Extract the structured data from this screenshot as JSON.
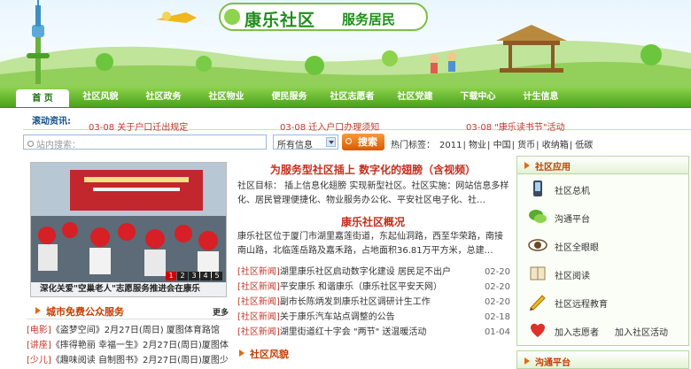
{
  "banner": {
    "title": "康乐社区",
    "slogan": "服务居民"
  },
  "nav": {
    "items": [
      "首 页",
      "社区风貌",
      "社区政务",
      "社区物业",
      "便民服务",
      "社区志愿者",
      "社区党建",
      "下载中心",
      "计生信息"
    ]
  },
  "ticker": {
    "label": "滚动资讯:",
    "rows": [
      {
        "date": "03-08",
        "title": "关于户口迁出规定",
        "y": "bot"
      },
      {
        "date": "03-08",
        "title": "迁入户口办理须知",
        "y": "bot"
      },
      {
        "date": "03-08",
        "title": "\"康乐读书节\"活动",
        "y": "bot"
      }
    ]
  },
  "search": {
    "placeholder": "站内搜索：",
    "select_value": "所有信息",
    "button_label": "搜索",
    "hot_label": "热门标签：",
    "hot_tags": [
      "2011",
      "物业",
      "中国",
      "货币",
      "收纳箱",
      "低碳"
    ]
  },
  "photo": {
    "caption": "深化关爱\"空巢老人\"志愿服务推进会在康乐",
    "pager": [
      "1",
      "2",
      "3",
      "4",
      "5"
    ],
    "active_page": "1"
  },
  "city_services": {
    "title": "城市免费公众服务",
    "more": "更多",
    "items": [
      {
        "tag": "[电影]",
        "text": "《盗梦空间》2月27日(周日) 厦图体育路馆"
      },
      {
        "tag": "[讲座]",
        "text": "《摔得艳丽 幸福一生》2月27日(周日)厦图体"
      },
      {
        "tag": "[少儿]",
        "text": "《趣味阅读 自制图书》2月27日(周日)厦图少"
      }
    ]
  },
  "center": {
    "headline": "为服务型社区插上 数字化的翅膀（含视频）",
    "para1": "社区目标： 插上信息化翅膀 实现新型社区。社区实施：网站信息多样化、居民管理便捷化、物业服务办公化、平安社区电子化、社…",
    "subhead": "康乐社区概况",
    "para2": "康乐社区位于厦门市湖里嘉莲街道，东起仙洞路，西至华荣路，南接南山路，北临莲岳路及嘉禾路，占地面积36.81万平方米，总建…",
    "news": [
      {
        "tag": "[社区新闻]",
        "title": "湖里康乐社区启动数字化建设 居民足不出户",
        "date": "02-20"
      },
      {
        "tag": "[社区新闻]",
        "title": "平安康乐 和谐康乐（康乐社区平安天网）",
        "date": "02-20"
      },
      {
        "tag": "[社区新闻]",
        "title": "副市长陈炳发到康乐社区调研计生工作",
        "date": "02-20"
      },
      {
        "tag": "[社区新闻]",
        "title": "关于康乐汽车站点调整的公告",
        "date": "02-18"
      },
      {
        "tag": "[社区新闻]",
        "title": "湖里街道红十字会 \"两节\" 送温暖活动",
        "date": "01-04"
      }
    ],
    "section_title": "社区风貌"
  },
  "right_panel": {
    "title": "社区应用",
    "apps": [
      {
        "icon": "phone-icon",
        "label": "社区总机"
      },
      {
        "icon": "chat-icon",
        "label": "沟通平台"
      },
      {
        "icon": "eye-icon",
        "label": "社区全眼眼"
      },
      {
        "icon": "book-icon",
        "label": "社区阅读"
      },
      {
        "icon": "pencil-icon",
        "label": "社区远程教育"
      },
      {
        "icon": "heart-icon",
        "label": "加入志愿者",
        "label2": "加入社区活动"
      }
    ],
    "second_title": "沟通平台"
  },
  "colors": {
    "nav_green": "#4aa11a",
    "title_red": "#c62d1d",
    "accent_orange": "#e26a10",
    "brand_green": "#1f8d1c"
  }
}
